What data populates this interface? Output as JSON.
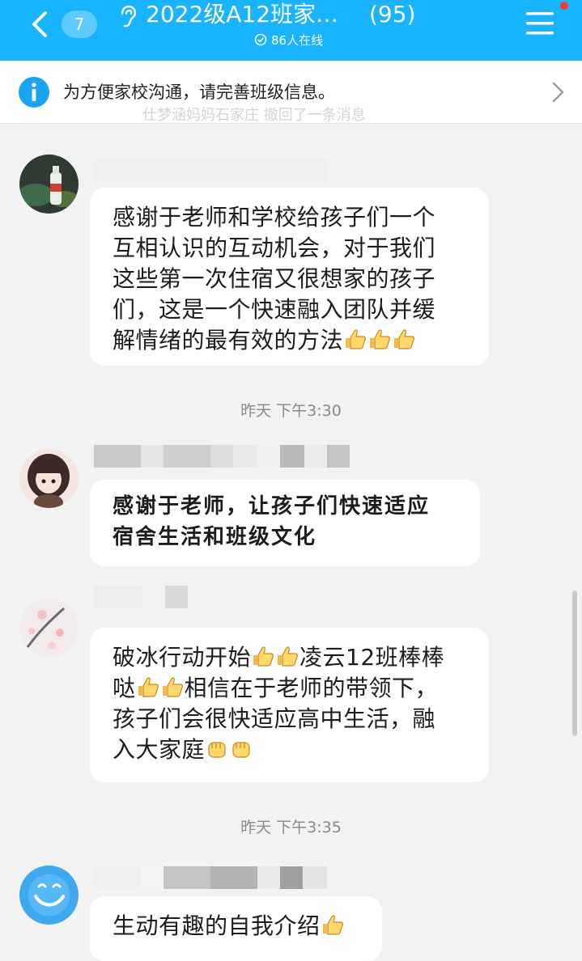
{
  "header": {
    "unread_count": "7",
    "group_title": "2022级A12班家…",
    "member_count": "(95)",
    "online_text": "86人在线"
  },
  "banner": {
    "text": "为方便家校沟通，请完善班级信息。",
    "recall_text": "仕梦涵妈妈石家庄 撤回了一条消息"
  },
  "messages": [
    {
      "text_lines": [
        "感谢于老师和学校给孩子们一个",
        "互相认识的互动机会，对于我们",
        "这些第一次住宿又很想家的孩子",
        "们，这是一个快速融入团队并缓",
        "解情绪的最有效的方法"
      ],
      "emoji": [
        "thumbs-up",
        "thumbs-up",
        "thumbs-up"
      ]
    },
    {
      "text_lines": [
        "感谢于老师，让孩子们快速适应",
        "宿舍生活和班级文化"
      ]
    },
    {
      "text_lines": [
        "破冰行动开始",
        "凌云12班棒棒",
        "哒",
        "相信在于老师的带领下，",
        "孩子们会很快适应高中生活，融",
        "入大家庭"
      ]
    },
    {
      "text_lines": [
        "生动有趣的自我介绍"
      ]
    }
  ],
  "timestamps": [
    "昨天 下午3:30",
    "昨天 下午3:35"
  ],
  "colors": {
    "header_bg": "#19b4ff",
    "chat_bg": "#f2f2f2",
    "bubble_bg": "#ffffff",
    "info_icon": "#1aa3ee",
    "notify_dot": "#ff3b30"
  }
}
